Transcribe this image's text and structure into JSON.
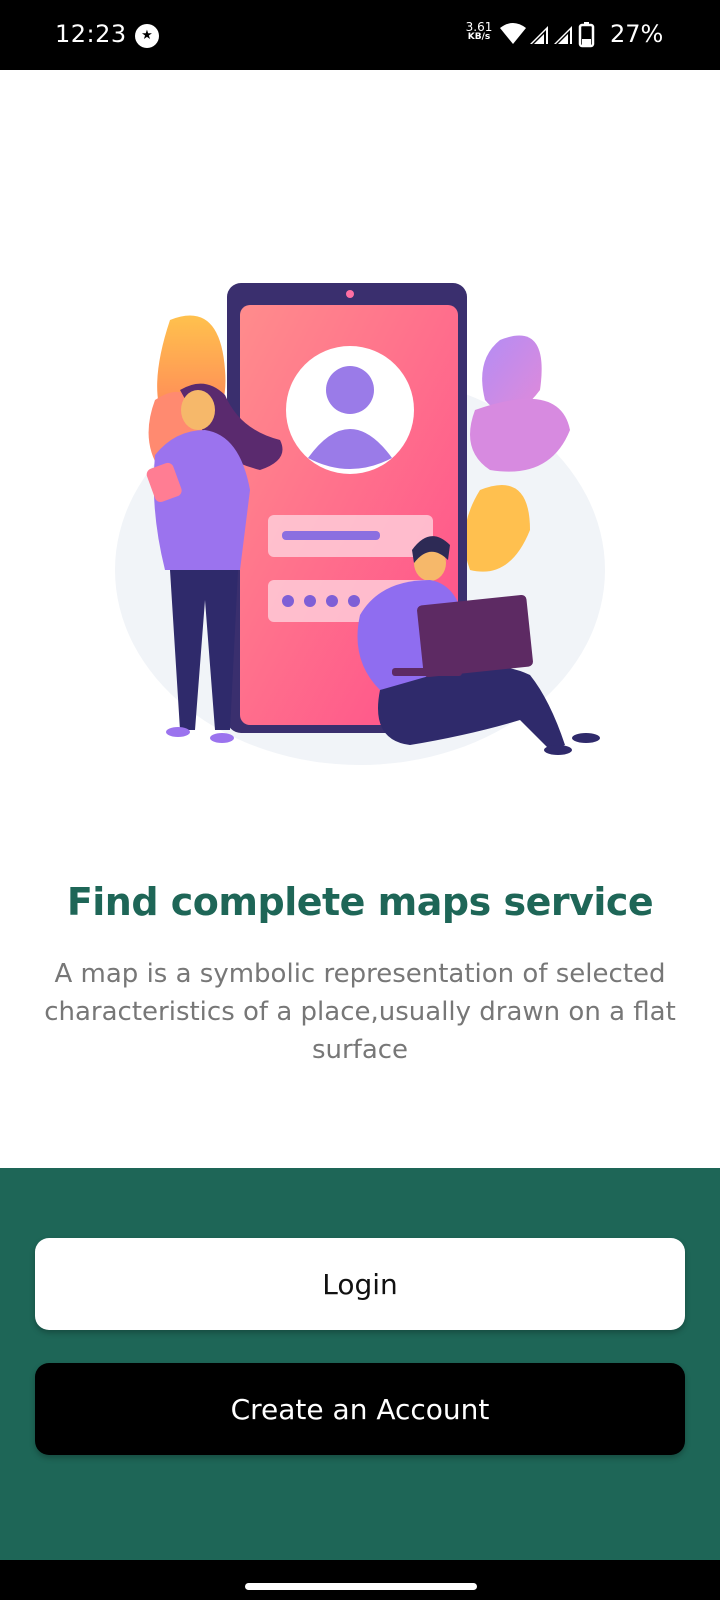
{
  "status_bar": {
    "time": "12:23",
    "net_speed_value": "3.61",
    "net_speed_unit": "KB/s",
    "battery": "27%",
    "icons": [
      "notification-dot-icon",
      "wifi-icon",
      "signal-icon",
      "signal-icon",
      "battery-icon"
    ]
  },
  "onboarding": {
    "headline": "Find complete maps service",
    "subtitle": "A map is a symbolic representation of selected characteristics of a place,usually drawn on a flat surface"
  },
  "actions": {
    "login_label": "Login",
    "create_account_label": "Create an Account"
  },
  "colors": {
    "brand": "#1e6657",
    "headline": "#1e6657",
    "subtitle": "#777777",
    "login_bg": "#ffffff",
    "create_bg": "#000000"
  }
}
